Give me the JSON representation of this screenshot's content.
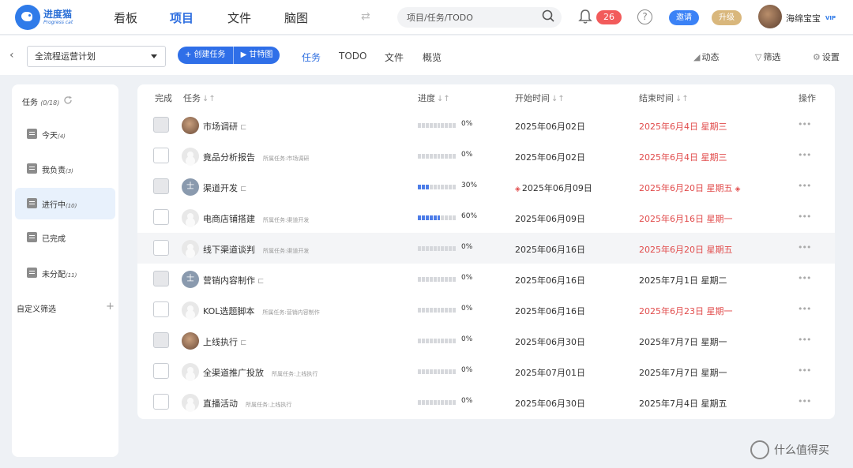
{
  "brand": {
    "name_cn": "进度猫",
    "name_en": "Progress cat"
  },
  "nav": {
    "items": [
      "看板",
      "项目",
      "文件",
      "脑图"
    ],
    "active_index": 1
  },
  "search": {
    "placeholder": "项目/任务/TODO"
  },
  "notifications": {
    "count": "26"
  },
  "header_buttons": {
    "help": "?",
    "invite": "邀请",
    "upgrade": "升级"
  },
  "user": {
    "name": "海绵宝宝",
    "tier": "VIP"
  },
  "toolbar": {
    "project": "全流程运营计划",
    "create_task": "+ 创建任务",
    "gantt": "▶ 甘特图",
    "tabs": [
      "任务",
      "TODO",
      "文件",
      "概览"
    ],
    "active_tab": 0,
    "activity": "动态",
    "filter": "筛选",
    "settings": "设置"
  },
  "sidebar": {
    "title": "任务",
    "title_count": "(0/18)",
    "items": [
      {
        "label": "今天",
        "count": "(4)"
      },
      {
        "label": "我负责",
        "count": "(3)"
      },
      {
        "label": "进行中",
        "count": "(10)"
      },
      {
        "label": "已完成",
        "count": ""
      },
      {
        "label": "未分配",
        "count": "(11)"
      }
    ],
    "active_index": 2,
    "custom_filter": "自定义筛选",
    "add": "+"
  },
  "table": {
    "columns": {
      "done": "完成",
      "task": "任务",
      "progress": "进度",
      "start": "开始时间",
      "end": "结束时间",
      "actions": "操作"
    },
    "parent_prefix": "所属任务:",
    "rows": [
      {
        "name": "市场调研",
        "avatar": "photo",
        "has_sub": true,
        "parent": "",
        "progress": 0,
        "progress_label": "0%",
        "start": "2025年06月02日",
        "end": "2025年6月4日 星期三",
        "late": true,
        "milestone": false,
        "checked": true
      },
      {
        "name": "竟品分析报告",
        "avatar": "gray",
        "has_sub": false,
        "parent": "市场调研",
        "progress": 0,
        "progress_label": "0%",
        "start": "2025年06月02日",
        "end": "2025年6月4日 星期三",
        "late": true,
        "milestone": false,
        "checked": false
      },
      {
        "name": "渠道开发",
        "avatar": "letter",
        "avatar_letter": "士",
        "has_sub": true,
        "parent": "",
        "progress": 0.3,
        "progress_label": "30%",
        "start": "2025年06月09日",
        "end": "2025年6月20日 星期五",
        "late": true,
        "milestone": true,
        "checked": true
      },
      {
        "name": "电商店铺搭建",
        "avatar": "gray",
        "has_sub": false,
        "parent": "渠道开发",
        "progress": 0.6,
        "progress_label": "60%",
        "start": "2025年06月09日",
        "end": "2025年6月16日 星期一",
        "late": true,
        "milestone": false,
        "checked": false
      },
      {
        "name": "线下渠道谈判",
        "avatar": "gray",
        "has_sub": false,
        "parent": "渠道开发",
        "progress": 0,
        "progress_label": "0%",
        "start": "2025年06月16日",
        "end": "2025年6月20日 星期五",
        "late": true,
        "milestone": false,
        "checked": false
      },
      {
        "name": "营销内容制作",
        "avatar": "letter",
        "avatar_letter": "士",
        "has_sub": true,
        "parent": "",
        "progress": 0,
        "progress_label": "0%",
        "start": "2025年06月16日",
        "end": "2025年7月1日 星期二",
        "late": false,
        "milestone": false,
        "checked": true
      },
      {
        "name": "KOL选题脚本",
        "avatar": "gray",
        "has_sub": false,
        "parent": "营销内容制作",
        "progress": 0,
        "progress_label": "0%",
        "start": "2025年06月16日",
        "end": "2025年6月23日 星期一",
        "late": true,
        "milestone": false,
        "checked": false
      },
      {
        "name": "上线执行",
        "avatar": "photo",
        "has_sub": true,
        "parent": "",
        "progress": 0,
        "progress_label": "0%",
        "start": "2025年06月30日",
        "end": "2025年7月7日 星期一",
        "late": false,
        "milestone": false,
        "checked": true
      },
      {
        "name": "全渠道推广投放",
        "avatar": "gray",
        "has_sub": false,
        "parent": "上线执行",
        "progress": 0,
        "progress_label": "0%",
        "start": "2025年07月01日",
        "end": "2025年7月7日 星期一",
        "late": false,
        "milestone": false,
        "checked": false
      },
      {
        "name": "直播活动",
        "avatar": "gray",
        "has_sub": false,
        "parent": "上线执行",
        "progress": 0,
        "progress_label": "0%",
        "start": "2025年06月30日",
        "end": "2025年7月4日 星期五",
        "late": false,
        "milestone": false,
        "checked": false
      }
    ],
    "hover_row": 4
  },
  "watermark": "什么值得买",
  "colors": {
    "accent": "#2f6fe0",
    "late": "#e14b4b",
    "badge": "#f25b5b",
    "upgrade": "#d9b77c"
  }
}
